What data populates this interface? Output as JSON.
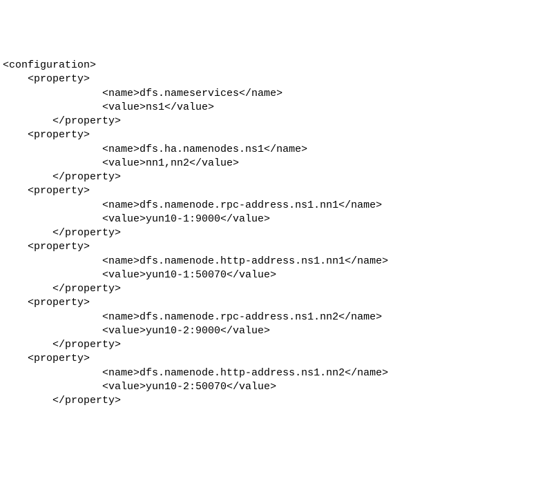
{
  "xml": {
    "root_open": "<configuration>",
    "properties": [
      {
        "open": "<property>",
        "name_open": "<name>",
        "name_val": "dfs.nameservices",
        "name_close": "</name>",
        "value_open": "<value>",
        "value_val": "ns1",
        "value_close": "</value>",
        "close": "</property>"
      },
      {
        "open": "<property>",
        "name_open": "<name>",
        "name_val": "dfs.ha.namenodes.ns1",
        "name_close": "</name>",
        "value_open": "<value>",
        "value_val": "nn1,nn2",
        "value_close": "</value>",
        "close": "</property>"
      },
      {
        "open": "<property>",
        "name_open": "<name>",
        "name_val": "dfs.namenode.rpc-address.ns1.nn1",
        "name_close": "</name>",
        "value_open": "<value>",
        "value_val": "yun10-1:9000",
        "value_close": "</value>",
        "close": "</property>"
      },
      {
        "open": "<property>",
        "name_open": "<name>",
        "name_val": "dfs.namenode.http-address.ns1.nn1",
        "name_close": "</name>",
        "value_open": "<value>",
        "value_val": "yun10-1:50070",
        "value_close": "</value>",
        "close": "</property>"
      },
      {
        "open": "<property>",
        "name_open": "<name>",
        "name_val": "dfs.namenode.rpc-address.ns1.nn2",
        "name_close": "</name>",
        "value_open": "<value>",
        "value_val": "yun10-2:9000",
        "value_close": "</value>",
        "close": "</property>"
      },
      {
        "open": "<property>",
        "name_open": "<name>",
        "name_val": "dfs.namenode.http-address.ns1.nn2",
        "name_close": "</name>",
        "value_open": "<value>",
        "value_val": "yun10-2:50070",
        "value_close": "</value>",
        "close": "</property>"
      }
    ]
  },
  "indent": {
    "none": "",
    "one": "    ",
    "two": "        ",
    "four": "                "
  }
}
